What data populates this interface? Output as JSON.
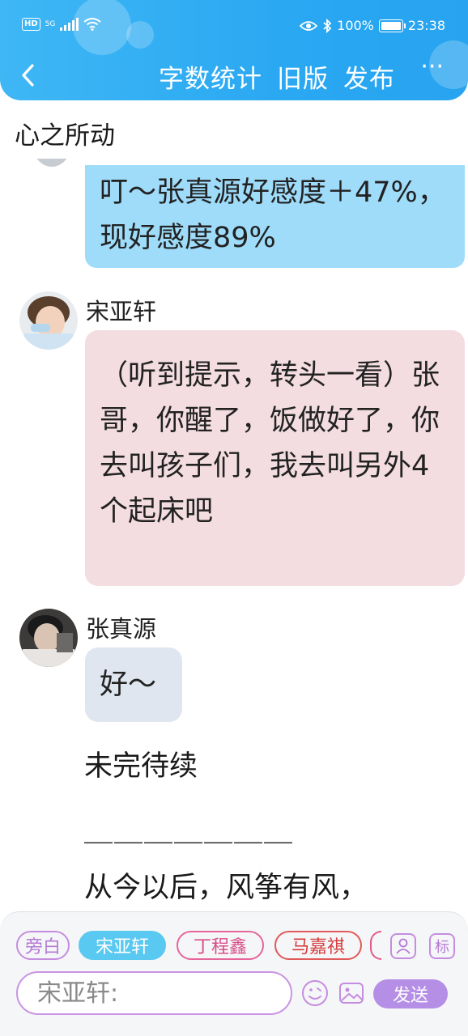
{
  "status_bar": {
    "hd": "HD",
    "network": "5G",
    "battery": "100%",
    "time": "23:38"
  },
  "nav": {
    "back_icon": "chevron-left-icon",
    "word_count": "字数统计",
    "old_version": "旧版",
    "publish": "发布",
    "more_icon": "more-dots-icon",
    "more": "···"
  },
  "story_title": "心之所动",
  "messages": {
    "system_text": "叮～张真源好感度＋47%，现好感度89%",
    "song_name": "宋亚轩",
    "song_text": "（听到提示，转头一看）张哥，你醒了，饭做好了，你去叫孩子们，我去叫另外4个起床吧",
    "zhang_name": "张真源",
    "zhang_text": "好～",
    "narration_1": "未完待续",
    "narration_2": "＿＿＿＿＿＿＿",
    "narration_3": "从今以后，风筝有风，"
  },
  "roles": {
    "narrator": "旁白",
    "song": "宋亚轩",
    "ding": "丁程鑫",
    "ma": "马嘉祺"
  },
  "input": {
    "placeholder": "宋亚轩:",
    "send": "发送"
  },
  "colors": {
    "header": "#2aa8f2",
    "system_bubble": "#9fdcfa",
    "song_bubble": "#f3dde1",
    "zhang_bubble": "#dfe6ef",
    "send_button": "#b58ee5",
    "active_role": "#59c9f1"
  }
}
